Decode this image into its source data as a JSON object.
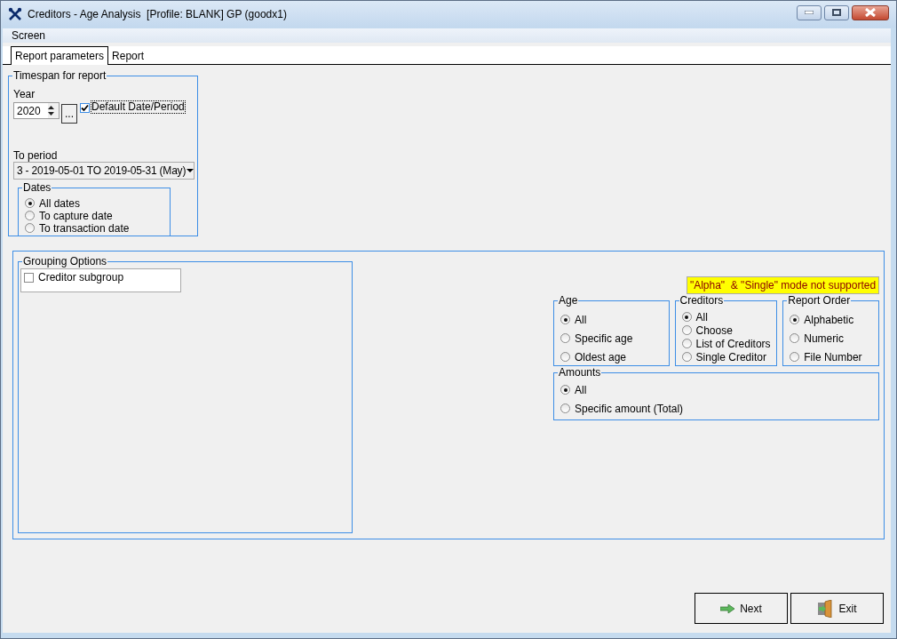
{
  "window": {
    "title": "Creditors - Age Analysis  [Profile: BLANK] GP (goodx1)"
  },
  "menu": [
    "Screen"
  ],
  "tabs": [
    {
      "label": "Report parameters",
      "selected": true
    },
    {
      "label": "Report",
      "selected": false
    }
  ],
  "timespan": {
    "title": "Timespan for report",
    "year_label": "Year",
    "year_value": "2020",
    "browse_button": "...",
    "default_checkbox": {
      "label": "Default Date/Period",
      "checked": true
    },
    "period_label": "To period",
    "period_value": "3  - 2019-05-01 TO 2019-05-31 (May)",
    "dates": {
      "title": "Dates",
      "options": [
        {
          "label": "All dates",
          "selected": true
        },
        {
          "label": "To capture date",
          "selected": false
        },
        {
          "label": "To transaction date",
          "selected": false
        }
      ]
    }
  },
  "grouping": {
    "title": "Grouping Options",
    "items": [
      {
        "label": "Creditor subgroup",
        "checked": false
      }
    ]
  },
  "notice": "\"Alpha\"  & \"Single\" mode not supported",
  "age": {
    "title": "Age",
    "options": [
      {
        "label": "All",
        "selected": true
      },
      {
        "label": "Specific age",
        "selected": false
      },
      {
        "label": "Oldest age",
        "selected": false
      }
    ]
  },
  "creditors": {
    "title": "Creditors",
    "options": [
      {
        "label": "All",
        "selected": true
      },
      {
        "label": "Choose",
        "selected": false
      },
      {
        "label": "List of Creditors",
        "selected": false
      },
      {
        "label": "Single Creditor",
        "selected": false
      }
    ]
  },
  "report_order": {
    "title": "Report Order",
    "options": [
      {
        "label": "Alphabetic",
        "selected": true
      },
      {
        "label": "Numeric",
        "selected": false
      },
      {
        "label": "File Number",
        "selected": false
      }
    ]
  },
  "amounts": {
    "title": "Amounts",
    "options": [
      {
        "label": "All",
        "selected": true
      },
      {
        "label": "Specific amount (Total)",
        "selected": false
      }
    ]
  },
  "buttons": [
    {
      "label": "Next",
      "kind": "next"
    },
    {
      "label": "Exit",
      "kind": "exit"
    }
  ]
}
